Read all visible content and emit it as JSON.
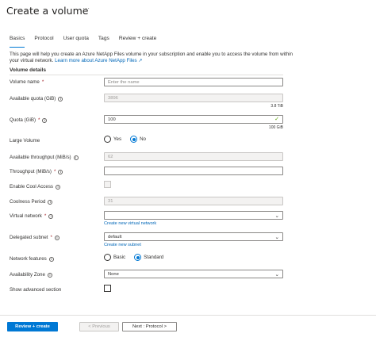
{
  "header": {
    "title": "Create a volume",
    "more": "···"
  },
  "tabs": [
    {
      "label": "Basics",
      "active": true
    },
    {
      "label": "Protocol",
      "active": false
    },
    {
      "label": "User quota",
      "active": false
    },
    {
      "label": "Tags",
      "active": false
    },
    {
      "label": "Review + create",
      "active": false
    }
  ],
  "intro": {
    "text": "This page will help you create an Azure NetApp Files volume in your subscription and enable you to access the volume from within your virtual network.",
    "link": "Learn more about Azure NetApp Files ↗"
  },
  "section": {
    "title": "Volume details"
  },
  "fields": {
    "volume_name": {
      "label": "Volume name",
      "required": "*",
      "placeholder": "Enter the name"
    },
    "available_quota": {
      "label": "Available quota (GiB)",
      "value": "3896",
      "hint": "3.8 TiB"
    },
    "quota": {
      "label": "Quota (GiB)",
      "required": "*",
      "value": "100",
      "hint": "100 GiB"
    },
    "large_volume": {
      "label": "Large Volume",
      "options": [
        "Yes",
        "No"
      ],
      "selected": "No"
    },
    "available_throughput": {
      "label": "Available throughput (MiB/s)",
      "value": "62"
    },
    "throughput": {
      "label": "Throughput (MiB/s)",
      "required": "*",
      "value": ""
    },
    "enable_cool_access": {
      "label": "Enable Cool Access",
      "checked": false
    },
    "coolness_period": {
      "label": "Coolness Period",
      "value": "31"
    },
    "virtual_network": {
      "label": "Virtual network",
      "required": "*",
      "value": "",
      "link": "Create new virtual network"
    },
    "delegated_subnet": {
      "label": "Delegated subnet",
      "required": "*",
      "value": "default",
      "link": "Create new subnet"
    },
    "network_features": {
      "label": "Network features",
      "options": [
        "Basic",
        "Standard"
      ],
      "selected": "Standard"
    },
    "availability_zone": {
      "label": "Availability Zone",
      "value": "None"
    },
    "show_advanced": {
      "label": "Show advanced section",
      "checked": false
    }
  },
  "footer": {
    "review_create": "Review + create",
    "previous": "< Previous",
    "next": "Next : Protocol >"
  },
  "colors": {
    "accent": "#0078d4",
    "link": "#0067b8",
    "required": "#a4262c",
    "valid": "#57a300"
  },
  "info_icon": "ⓘ"
}
